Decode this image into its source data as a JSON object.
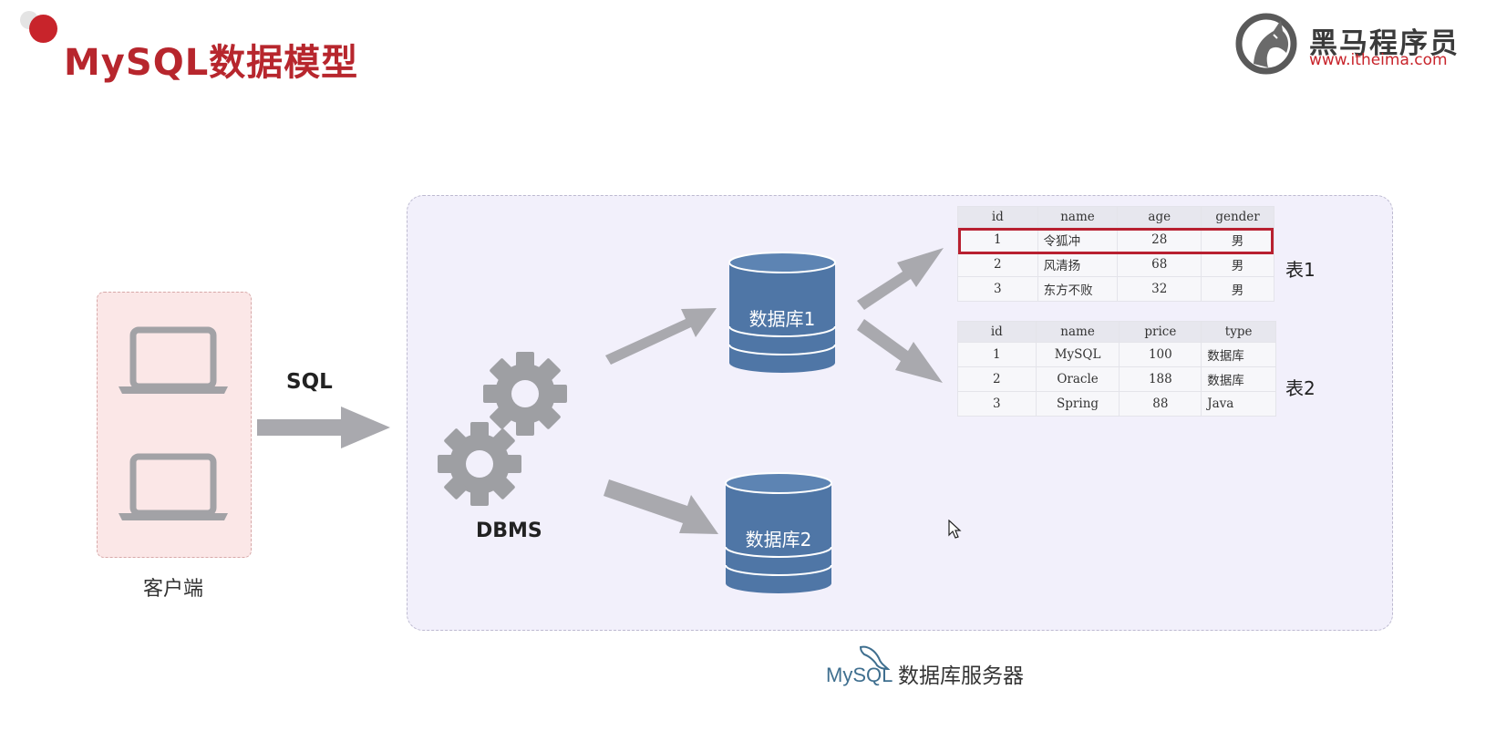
{
  "title": "MySQL数据模型",
  "brand": {
    "name": "黑马程序员",
    "url": "www.itheima.com"
  },
  "client": {
    "label": "客户端"
  },
  "arrow_label": "SQL",
  "dbms_label": "DBMS",
  "databases": [
    {
      "label": "数据库1"
    },
    {
      "label": "数据库2"
    }
  ],
  "table1": {
    "label": "表1",
    "columns": [
      "id",
      "name",
      "age",
      "gender"
    ],
    "rows": [
      [
        "1",
        "令狐冲",
        "28",
        "男"
      ],
      [
        "2",
        "风清扬",
        "68",
        "男"
      ],
      [
        "3",
        "东方不败",
        "32",
        "男"
      ]
    ],
    "highlighted_row": 0
  },
  "table2": {
    "label": "表2",
    "columns": [
      "id",
      "name",
      "price",
      "type"
    ],
    "rows": [
      [
        "1",
        "MySQL",
        "100",
        "数据库"
      ],
      [
        "2",
        "Oracle",
        "188",
        "数据库"
      ],
      [
        "3",
        "Spring",
        "88",
        "Java"
      ]
    ]
  },
  "server_label": "数据库服务器",
  "mysql_logo_text": "MySQL",
  "colors": {
    "title": "#b7262d",
    "database": "#4f76a6",
    "arrow": "#a9a9ae",
    "highlight": "#b82030",
    "client_bg": "#fbe7e7",
    "server_bg": "#f2f0fb"
  }
}
